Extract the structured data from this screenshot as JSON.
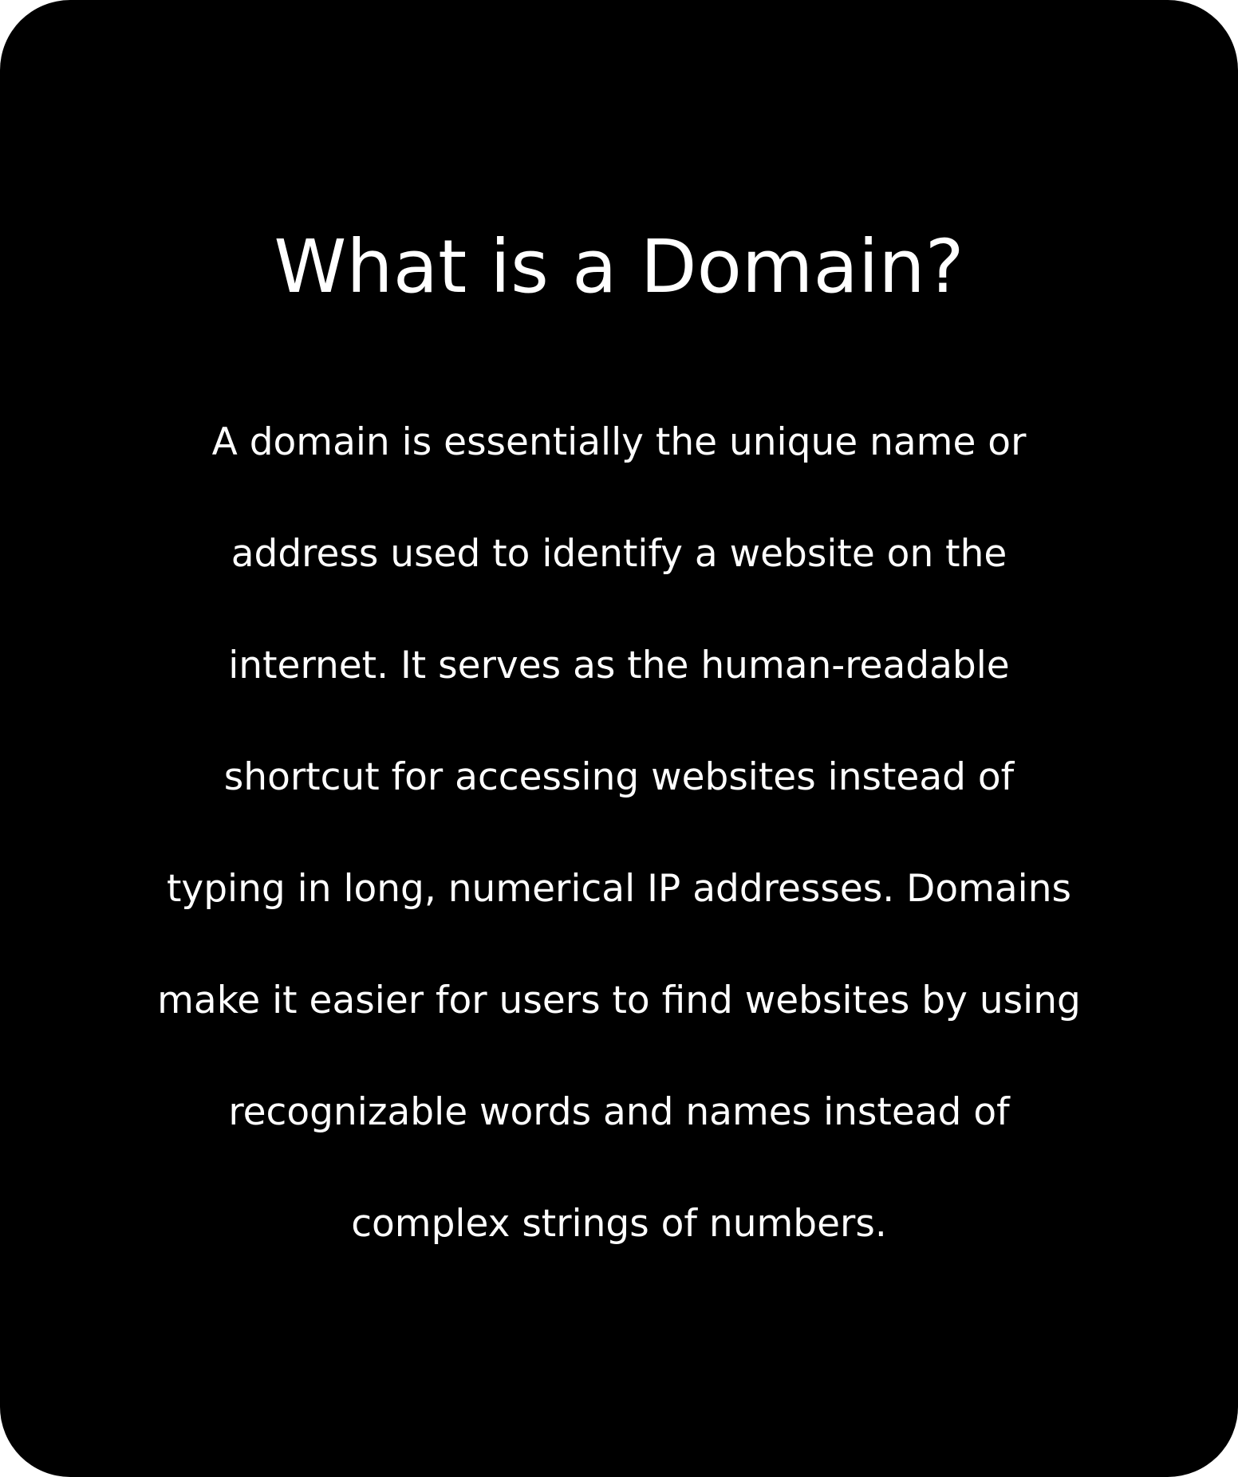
{
  "title": "What is a Domain?",
  "paragraph_lines": [
    "A domain is essentially the unique name or",
    "address used to identify a website on the",
    "internet. It serves as the human-readable",
    "shortcut for accessing websites instead of",
    "typing in long, numerical IP addresses. Domains",
    "make it easier for users to find websites by using",
    "recognizable words and names instead of",
    "complex strings of numbers."
  ],
  "colors": {
    "background": "#000000",
    "text": "#ffffff"
  }
}
